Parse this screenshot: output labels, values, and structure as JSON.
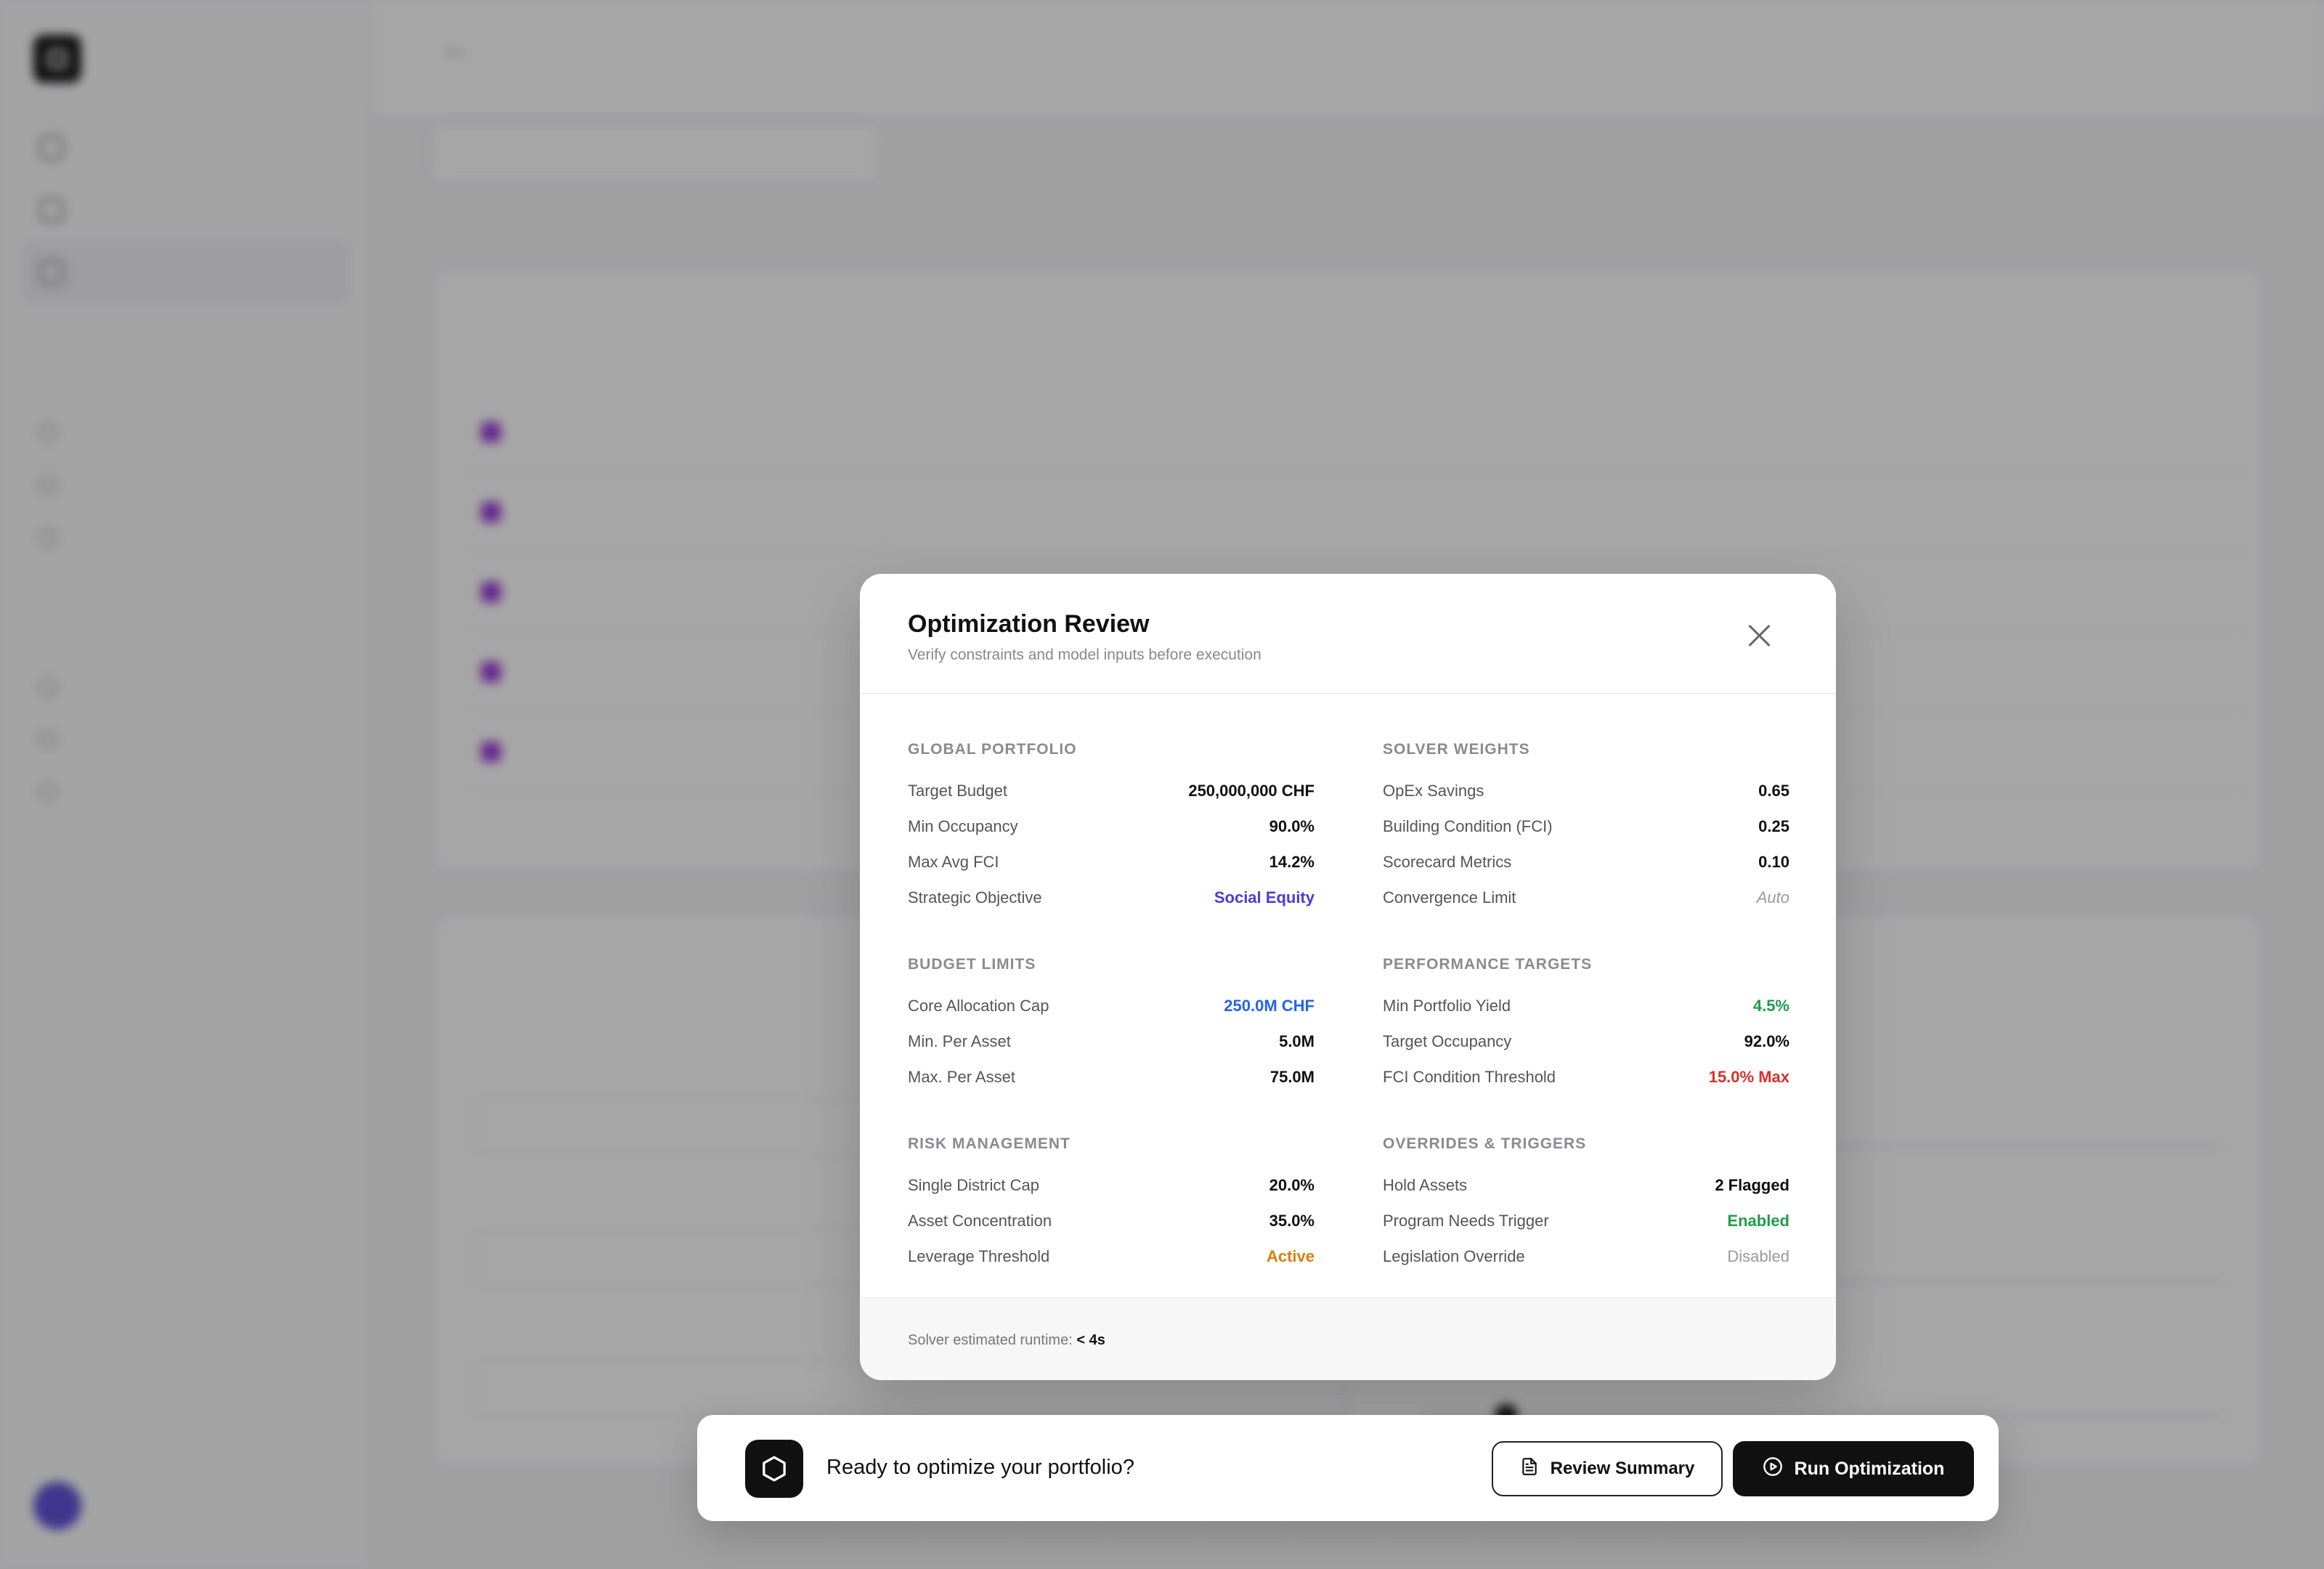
{
  "modal": {
    "title": "Optimization Review",
    "subtitle": "Verify constraints and model inputs before execution",
    "left_groups": [
      {
        "title": "GLOBAL PORTFOLIO",
        "rows": [
          {
            "label": "Target Budget",
            "value": "250,000,000 CHF"
          },
          {
            "label": "Min Occupancy",
            "value": "90.0%"
          },
          {
            "label": "Max Avg FCI",
            "value": "14.2%"
          },
          {
            "label": "Strategic Objective",
            "value": "Social Equity"
          }
        ]
      },
      {
        "title": "BUDGET LIMITS",
        "rows": [
          {
            "label": "Core Allocation Cap",
            "value": "250.0M CHF"
          },
          {
            "label": "Min. Per Asset",
            "value": "5.0M"
          },
          {
            "label": "Max. Per Asset",
            "value": "75.0M"
          }
        ]
      },
      {
        "title": "RISK MANAGEMENT",
        "rows": [
          {
            "label": "Single District Cap",
            "value": "20.0%"
          },
          {
            "label": "Asset Concentration",
            "value": "35.0%"
          },
          {
            "label": "Leverage Threshold",
            "value": "Active"
          }
        ]
      }
    ],
    "right_groups": [
      {
        "title": "SOLVER WEIGHTS",
        "rows": [
          {
            "label": "OpEx Savings",
            "value": "0.65"
          },
          {
            "label": "Building Condition (FCI)",
            "value": "0.25"
          },
          {
            "label": "Scorecard Metrics",
            "value": "0.10"
          },
          {
            "label": "Convergence Limit",
            "value": "Auto"
          }
        ]
      },
      {
        "title": "PERFORMANCE TARGETS",
        "rows": [
          {
            "label": "Min Portfolio Yield",
            "value": "4.5%"
          },
          {
            "label": "Target Occupancy",
            "value": "92.0%"
          },
          {
            "label": "FCI Condition Threshold",
            "value": "15.0% Max"
          }
        ]
      },
      {
        "title": "OVERRIDES & TRIGGERS",
        "rows": [
          {
            "label": "Hold Assets",
            "value": "2 Flagged"
          },
          {
            "label": "Program Needs Trigger",
            "value": "Enabled"
          },
          {
            "label": "Legislation Override",
            "value": "Disabled"
          }
        ]
      }
    ],
    "footer": {
      "label": "Solver estimated runtime:",
      "value": "< 4s"
    }
  },
  "action_bar": {
    "prompt": "Ready to optimize your portfolio?",
    "review_label": "Review Summary",
    "run_label": "Run Optimization"
  },
  "colors": {
    "accent_purple": "#4a3cd8",
    "accent_blue": "#2563eb",
    "positive_green": "#1f9d4a",
    "warning_red": "#d9302a",
    "active_orange": "#e07b0c",
    "primary_dark": "#111111"
  },
  "icons": [
    "close-icon",
    "hexagon-icon",
    "document-icon",
    "play-circle-icon"
  ]
}
